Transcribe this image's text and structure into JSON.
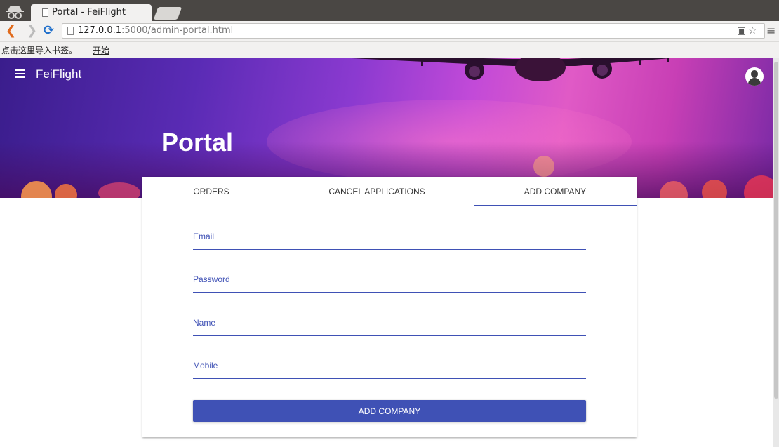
{
  "browser": {
    "tab_title": "Portal - FeiFlight",
    "tab_close": "×",
    "url_host": "127.0.0.1",
    "url_rest": ":5000/admin-portal.html",
    "bookmarks_text": "点击这里导入书签。",
    "bookmarks_link": "开始",
    "icons": [
      "incognito-icon",
      "page-icon",
      "back-arrow-icon",
      "forward-arrow-icon",
      "reload-icon",
      "translate-icon",
      "star-icon",
      "menu-icon"
    ]
  },
  "app": {
    "brand": "FeiFlight",
    "heading": "Portal",
    "accent_color": "#3f51b5"
  },
  "tabs": [
    {
      "label": "ORDERS",
      "active": false
    },
    {
      "label": "CANCEL APPLICATIONS",
      "active": false
    },
    {
      "label": "ADD COMPANY",
      "active": true
    }
  ],
  "form": {
    "email_label": "Email",
    "password_label": "Password",
    "name_label": "Name",
    "mobile_label": "Mobile",
    "submit_label": "ADD COMPANY"
  }
}
